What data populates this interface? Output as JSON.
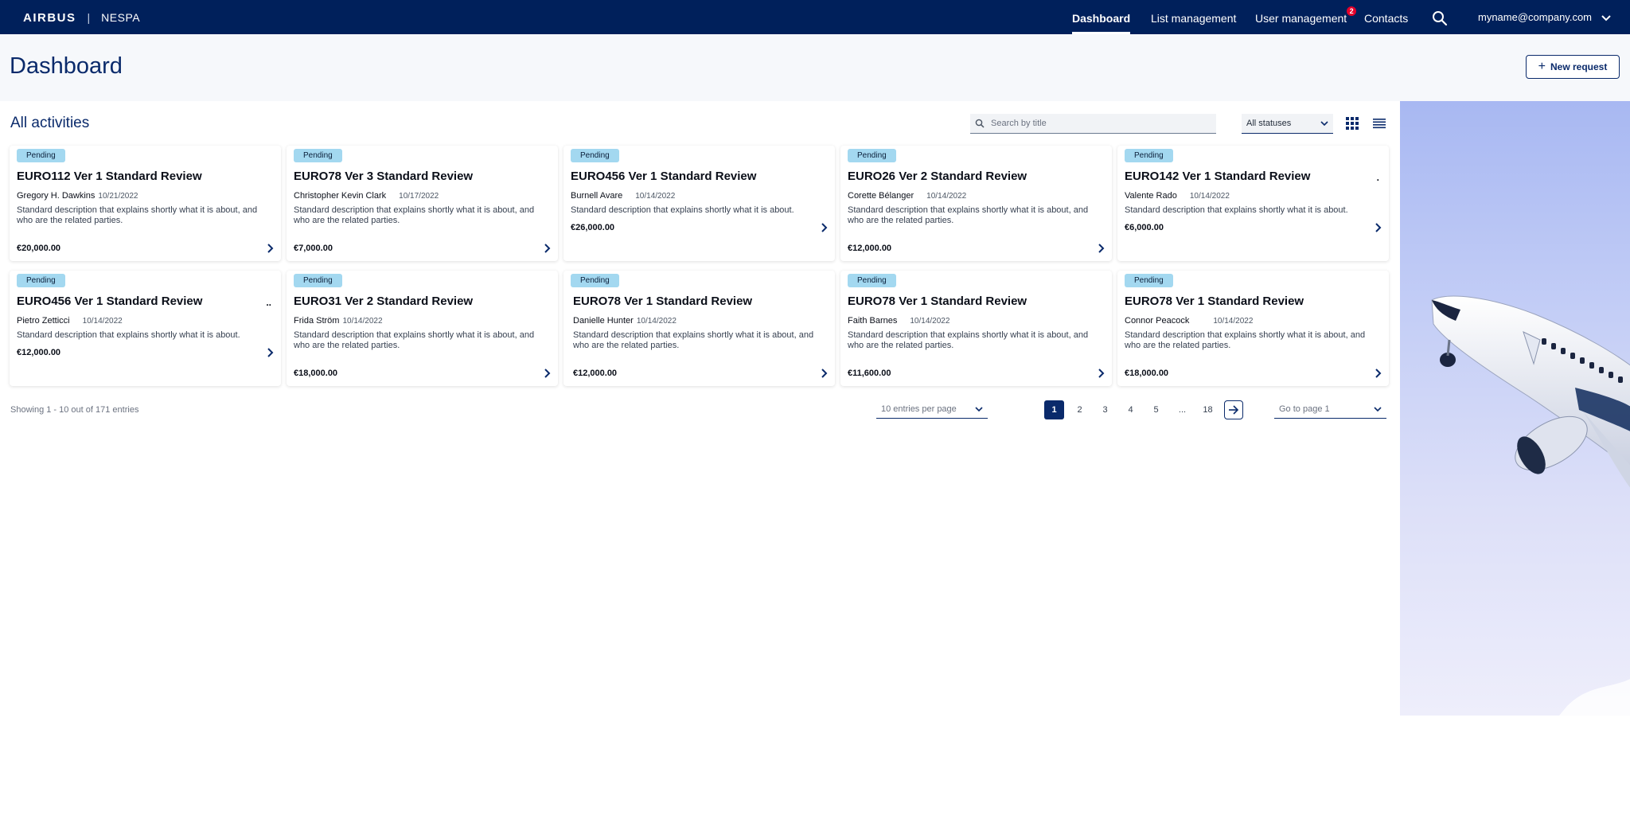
{
  "brand": {
    "logo": "AIRBUS",
    "separator": "|",
    "app": "NESPA"
  },
  "nav": {
    "items": [
      {
        "label": "Dashboard",
        "active": true
      },
      {
        "label": "List management",
        "active": false
      },
      {
        "label": "User management",
        "active": false,
        "badge": "2"
      },
      {
        "label": "Contacts",
        "active": false
      }
    ],
    "search_icon": "search-icon",
    "user": "myname@company.com"
  },
  "header": {
    "title": "Dashboard",
    "new_request_label": "New request"
  },
  "activities": {
    "title": "All activities",
    "search_placeholder": "Search by title",
    "status_filter": "All statuses"
  },
  "cards": [
    {
      "status": "Pending",
      "title": "EURO112 Ver 1 Standard Review",
      "person": "Gregory H. Dawkins",
      "date": "10/21/2022",
      "description": "Standard description that explains shortly what it is about, and who are the related parties.",
      "amount": "€20,000.00",
      "menu": ""
    },
    {
      "status": "Pending",
      "title": "EURO78 Ver 3 Standard Review",
      "person": "Christopher Kevin Clark",
      "date": "10/17/2022",
      "description": "Standard description that explains shortly what it is about, and who are the related parties.",
      "amount": "€7,000.00",
      "menu": ""
    },
    {
      "status": "Pending",
      "title": "EURO456 Ver 1 Standard Review",
      "person": "Burnell Avare",
      "date": "10/14/2022",
      "description": "Standard description that explains shortly what it is about.",
      "amount": "€26,000.00",
      "menu": ""
    },
    {
      "status": "Pending",
      "title": "EURO26 Ver 2 Standard Review",
      "person": "Corette Bélanger",
      "date": "10/14/2022",
      "description": "Standard description that explains shortly what it is about, and who are the related parties.",
      "amount": "€12,000.00",
      "menu": ""
    },
    {
      "status": "Pending",
      "title": "EURO142 Ver 1 Standard Review",
      "person": "Valente Rado",
      "date": "10/14/2022",
      "description": "Standard description that explains shortly what it is about.",
      "amount": "€6,000.00",
      "menu": "."
    },
    {
      "status": "Pending",
      "title": "EURO456 Ver 1 Standard Review",
      "person": "Pietro Zetticci",
      "date": "10/14/2022",
      "description": "Standard description that explains shortly what it is about.",
      "amount": "€12,000.00",
      "menu": ".."
    },
    {
      "status": "Pending",
      "title": "EURO31 Ver 2 Standard Review",
      "person": "Frida Ström",
      "date": "10/14/2022",
      "description": "Standard description that explains shortly what it is about, and who are the related parties.",
      "amount": "€18,000.00",
      "menu": ""
    },
    {
      "status": "Pending",
      "title": "EURO78 Ver 1 Standard Review",
      "person": "Danielle Hunter",
      "date": "10/14/2022",
      "description": "Standard description that explains shortly what it is about, and who are the related parties.",
      "amount": "€12,000.00",
      "menu": ""
    },
    {
      "status": "Pending",
      "title": "EURO78 Ver 1 Standard Review",
      "person": "Faith Barnes",
      "date": "10/14/2022",
      "description": "Standard description that explains shortly what it is about, and who are the related parties.",
      "amount": "€11,600.00",
      "menu": ""
    },
    {
      "status": "Pending",
      "title": "EURO78 Ver 1 Standard Review",
      "person": "Connor Peacock",
      "date": "10/14/2022",
      "description": "Standard description that explains shortly what it is about, and who are the related parties.",
      "amount": "€18,000.00",
      "menu": ""
    }
  ],
  "pagination": {
    "showing": "Showing 1 - 10 out of 171 entries",
    "per_page": "10 entries per page",
    "pages": [
      "1",
      "2",
      "3",
      "4",
      "5",
      "...",
      "18"
    ],
    "current_page": "1",
    "goto": "Go to page 1"
  },
  "colors": {
    "navy": "#00205b",
    "accent": "#0a2a6b",
    "pending_tag": "#a3d8f0",
    "badge": "#e4002b"
  }
}
